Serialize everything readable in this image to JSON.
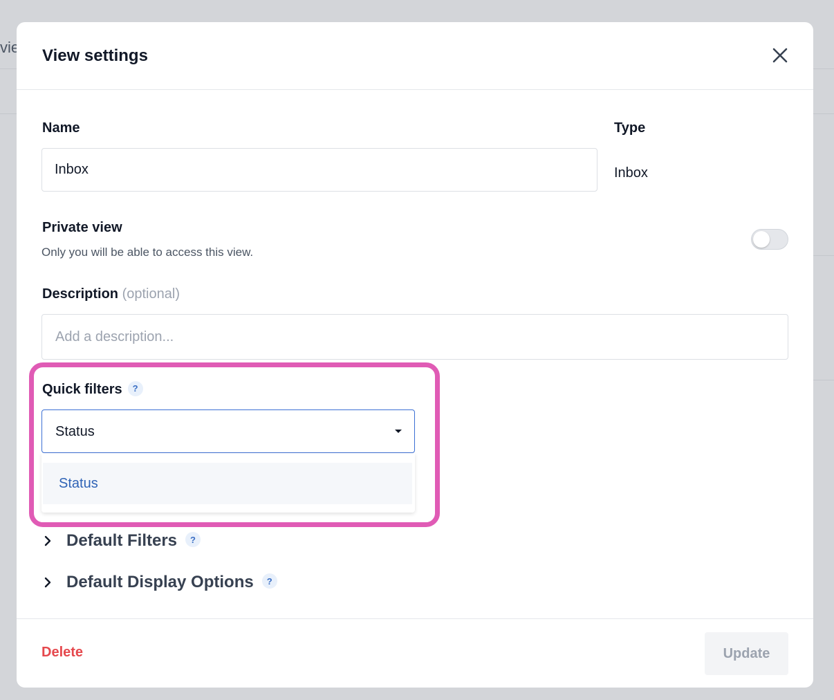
{
  "background": {
    "tab_fragment": "vie"
  },
  "modal": {
    "title": "View settings",
    "close_icon": "close-icon"
  },
  "form": {
    "name_label": "Name",
    "name_value": "Inbox",
    "type_label": "Type",
    "type_value": "Inbox",
    "private_label": "Private view",
    "private_description": "Only you will be able to access this view.",
    "private_enabled": false,
    "description_label": "Description",
    "description_optional": "(optional)",
    "description_placeholder": "Add a description...",
    "quick_filters_label": "Quick filters",
    "help_mark": "?",
    "quick_filters_selected": "Status",
    "quick_filters_options": [
      "Status"
    ]
  },
  "sections": {
    "default_filters": "Default Filters",
    "default_display_options": "Default Display Options"
  },
  "footer": {
    "delete_label": "Delete",
    "update_label": "Update"
  },
  "colors": {
    "accent": "#2f63b6",
    "danger": "#e5484d",
    "highlight": "#e05bb5"
  }
}
